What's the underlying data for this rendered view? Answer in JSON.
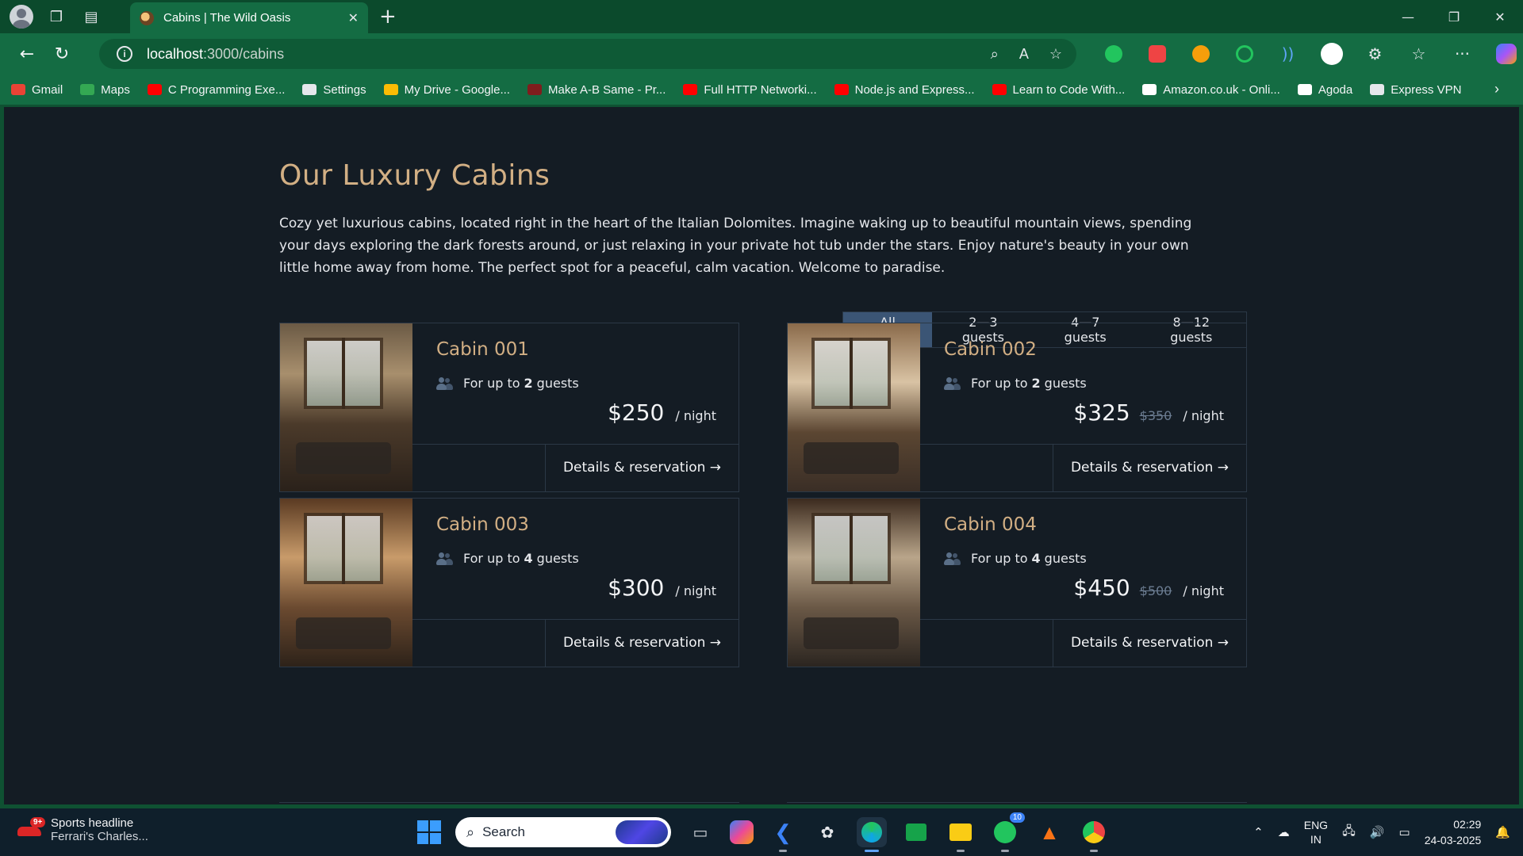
{
  "browser": {
    "tab_title": "Cabins | The Wild Oasis",
    "url_host": "localhost",
    "url_path": ":3000/cabins",
    "bookmarks": [
      {
        "label": "Gmail",
        "icon": "gmail-icon",
        "color": "#ea4335"
      },
      {
        "label": "Maps",
        "icon": "maps-icon",
        "color": "#34a853"
      },
      {
        "label": "C Programming Exe...",
        "icon": "youtube-icon",
        "color": "#ff0000"
      },
      {
        "label": "Settings",
        "icon": "gear-icon",
        "color": "#e5e7eb"
      },
      {
        "label": "My Drive - Google...",
        "icon": "drive-icon",
        "color": "#fbbc04"
      },
      {
        "label": "Make A-B Same - Pr...",
        "icon": "codechef-icon",
        "color": "#7f1d1d"
      },
      {
        "label": "Full HTTP Networki...",
        "icon": "youtube-icon",
        "color": "#ff0000"
      },
      {
        "label": "Node.js and Express...",
        "icon": "youtube-icon",
        "color": "#ff0000"
      },
      {
        "label": "Learn to Code With...",
        "icon": "youtube-icon",
        "color": "#ff0000"
      },
      {
        "label": "Amazon.co.uk - Onli...",
        "icon": "amazon-icon",
        "color": "#ffffff"
      },
      {
        "label": "Agoda",
        "icon": "agoda-icon",
        "color": "#ffffff"
      },
      {
        "label": "Express VPN",
        "icon": "globe-icon",
        "color": "#e5e7eb"
      }
    ]
  },
  "page": {
    "heading": "Our Luxury Cabins",
    "intro": "Cozy yet luxurious cabins, located right in the heart of the Italian Dolomites. Imagine waking up to beautiful mountain views, spending your days exploring the dark forests around, or just relaxing in your private hot tub under the stars. Enjoy nature's beauty in your own little home away from home. The perfect spot for a peaceful, calm vacation. Welcome to paradise.",
    "filters": [
      "All cabins",
      "2—3 guests",
      "4—7 guests",
      "8—12 guests"
    ],
    "active_filter": "All cabins",
    "guests_prefix": "For up to",
    "guests_suffix": "guests",
    "per_night": "/ night",
    "details_label": "Details & reservation →",
    "cabins": [
      {
        "name": "Cabin 001",
        "guests": "2",
        "price": "$250",
        "old_price": ""
      },
      {
        "name": "Cabin 002",
        "guests": "2",
        "price": "$325",
        "old_price": "$350"
      },
      {
        "name": "Cabin 003",
        "guests": "4",
        "price": "$300",
        "old_price": ""
      },
      {
        "name": "Cabin 004",
        "guests": "4",
        "price": "$450",
        "old_price": "$500"
      }
    ]
  },
  "taskbar": {
    "news_title": "Sports headline",
    "news_sub": "Ferrari's Charles...",
    "news_badge": "9+",
    "search_placeholder": "Search",
    "whatsapp_badge": "10",
    "lang_1": "ENG",
    "lang_2": "IN",
    "time": "02:29",
    "date": "24-03-2025"
  },
  "colors": {
    "accent_gold": "#d2af84",
    "active_filter": "#3b5575",
    "page_bg": "#141c24",
    "chrome_green": "#146c43"
  }
}
